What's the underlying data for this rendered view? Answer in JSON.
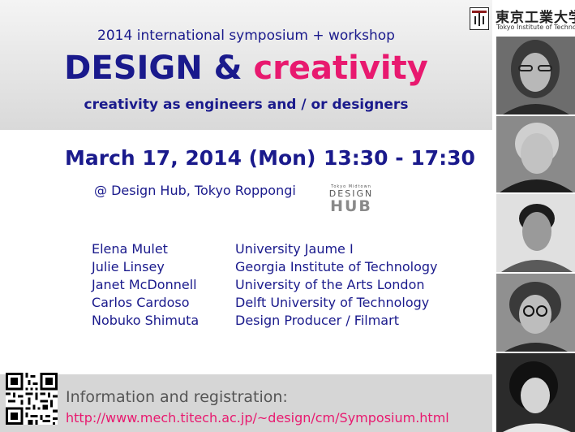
{
  "header": {
    "subtitle": "2014 international symposium + workshop",
    "title_part1": "DESIGN & ",
    "title_part2": "creativity",
    "tagline": "creativity as engineers and / or designers"
  },
  "event": {
    "date": "March 17, 2014 (Mon)",
    "time": "13:30 - 17:30",
    "venue": "@ Design Hub, Tokyo Roppongi"
  },
  "venue_logo": {
    "small": "Tokyo Midtown",
    "design": "DESIGN",
    "hub": "HUB"
  },
  "speakers": [
    {
      "name": "Elena Mulet",
      "affiliation": "University Jaume I"
    },
    {
      "name": "Julie Linsey",
      "affiliation": "Georgia Institute of Technology"
    },
    {
      "name": "Janet McDonnell",
      "affiliation": "University of the Arts London"
    },
    {
      "name": "Carlos Cardoso",
      "affiliation": "Delft University of Technology"
    },
    {
      "name": "Nobuko Shimuta",
      "affiliation": "Design Producer / Filmart"
    }
  ],
  "footer": {
    "info_label": "Information and registration:",
    "url": "http://www.mech.titech.ac.jp/~design/cm/Symposium.html"
  },
  "institution": {
    "name_jp": "東京工業大学",
    "name_en": "Tokyo Institute of Technology"
  },
  "colors": {
    "navy": "#1a1a8c",
    "accent_pink": "#e8196f",
    "band_gray": "#d9d9d9"
  }
}
